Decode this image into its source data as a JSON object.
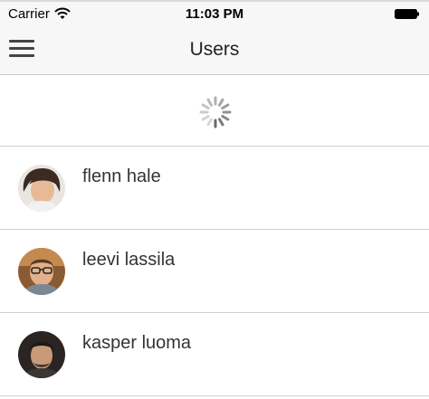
{
  "status_bar": {
    "carrier": "Carrier",
    "time": "11:03 PM",
    "wifi_icon": "wifi-icon",
    "battery_icon": "battery-icon"
  },
  "nav": {
    "title": "Users",
    "menu_icon": "hamburger-menu-icon"
  },
  "loading": {
    "icon": "spinner-icon"
  },
  "users": [
    {
      "name": "flenn hale"
    },
    {
      "name": "leevi lassila"
    },
    {
      "name": "kasper luoma"
    }
  ],
  "colors": {
    "bar_background": "#f7f7f7",
    "separator": "#d0d0d0",
    "text": "#333333"
  }
}
